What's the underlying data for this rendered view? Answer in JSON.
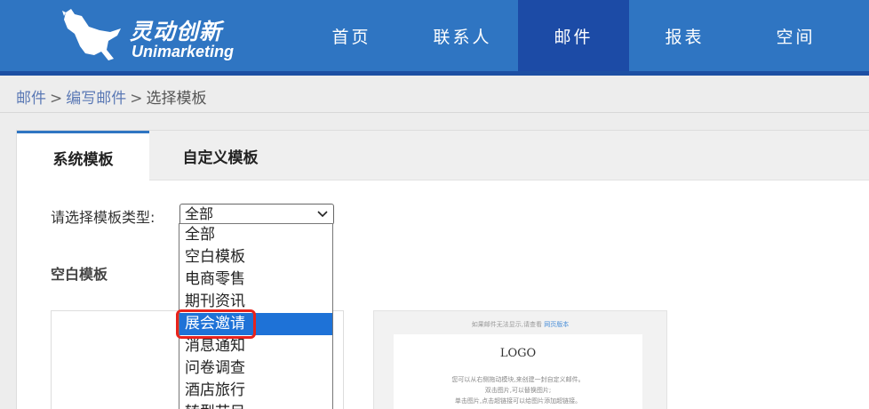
{
  "header": {
    "logo_cn": "灵动创新",
    "logo_en": "Unimarketing",
    "nav": [
      "首页",
      "联系人",
      "邮件",
      "报表",
      "空间"
    ],
    "active_nav": "邮件"
  },
  "breadcrumb": {
    "items": [
      "邮件",
      "编写邮件"
    ],
    "separator": ">",
    "current": "选择模板"
  },
  "tabs": {
    "system": "系统模板",
    "custom": "自定义模板"
  },
  "filter": {
    "label": "请选择模板类型:",
    "selected": "全部"
  },
  "dropdown": {
    "options": [
      "全部",
      "空白模板",
      "电商零售",
      "期刊资讯",
      "展会邀请",
      "消息通知",
      "问卷调查",
      "酒店旅行",
      "转型节目"
    ],
    "highlighted": "展会邀请"
  },
  "section": {
    "title": "空白模板"
  },
  "preview": {
    "hint": "如果邮件无法显示,请查看",
    "hint_link": "网页版本",
    "logo": "LOGO",
    "lines": [
      "您可以从右侧拖动模块,来创建一封自定义邮件。",
      "双击图片,可以替换图片;",
      "单击图片,点击超链接可以给图片添加超链接。"
    ]
  },
  "colors": {
    "header_bg": "#2f75c2",
    "active_nav_bg": "#1c4ba6",
    "highlight": "#1e72d7",
    "annotation": "#e8231c"
  }
}
